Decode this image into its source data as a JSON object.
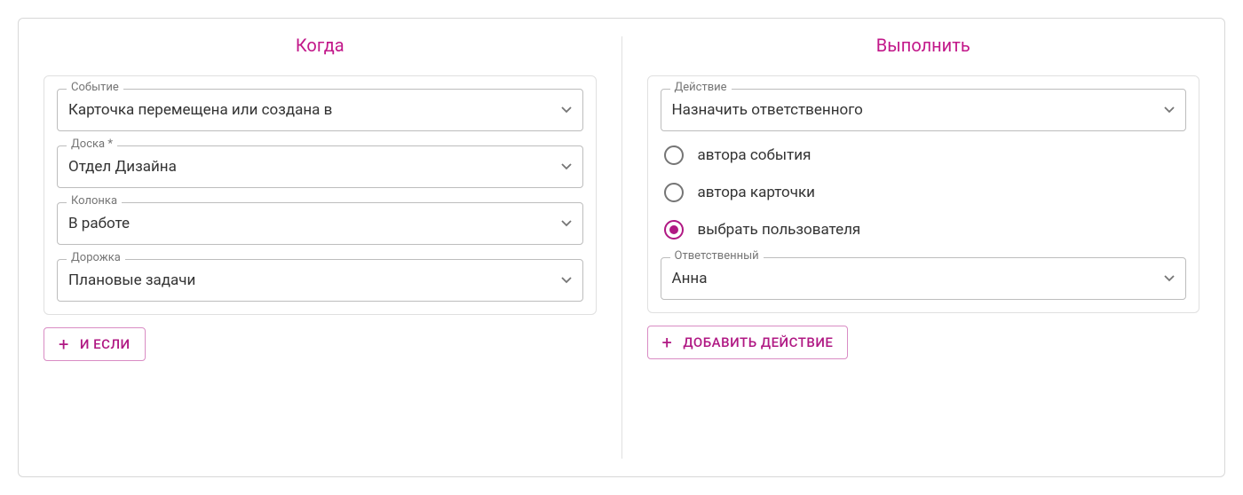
{
  "when": {
    "title": "Когда",
    "fields": {
      "event": {
        "label": "Событие",
        "value": "Карточка перемещена или создана в"
      },
      "board": {
        "label": "Доска *",
        "value": "Отдел Дизайна"
      },
      "column": {
        "label": "Колонка",
        "value": "В работе"
      },
      "lane": {
        "label": "Дорожка",
        "value": "Плановые задачи"
      }
    },
    "add_if_label": "И ЕСЛИ"
  },
  "execute": {
    "title": "Выполнить",
    "action_field": {
      "label": "Действие",
      "value": "Назначить ответственного"
    },
    "radios": {
      "event_author": "автора события",
      "card_author": "автора карточки",
      "choose_user": "выбрать пользователя"
    },
    "responsible_field": {
      "label": "Ответственный",
      "value": "Анна"
    },
    "add_action_label": "ДОБАВИТЬ ДЕЙСТВИЕ"
  }
}
